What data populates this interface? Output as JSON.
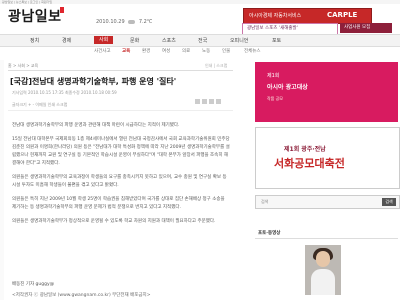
{
  "header": {
    "toplinks": "광남일보 | 뉴스특보 | 로그인 | 회원가입",
    "logo": "광남일보",
    "date": "2010.10.29",
    "temperature": "7.2℃"
  },
  "ads": {
    "ad1_text": "아시아경제 자동차서비스",
    "ad1_brand": "CARPLE",
    "ad2_text": "광남일보 스포츠 '새해출발'",
    "ad3_text": "사업사원 모집"
  },
  "nav": {
    "items": [
      "정치",
      "경제",
      "사회",
      "문화",
      "스포츠",
      "전국",
      "오피니언",
      "포토"
    ]
  },
  "subnav": {
    "items": [
      "사건사고",
      "교육",
      "환경",
      "여성",
      "의료",
      "노동",
      "인물",
      "전체뉴스"
    ]
  },
  "article": {
    "breadcrumb": "홈 > 사회 > 교육",
    "breadcrumb_right": "인쇄 | 스크랩",
    "headline": "[국감]전남대 생명과학기술학부, 파행 운영 '질타'",
    "meta1": "기사입력 2010.10.15 17:35    최종수정 2010.10.18 00:59",
    "meta2": "글자크기  +  -   이메일  인쇄  스크랩",
    "body": [
      "전남대 생명과학기술학부의 파행 운영과 관련해 대책 마련이 시급하다는 지적이 제기됐다.",
      "15일 전남대 대학본부 국제회의동 1층 제4세미나실에서 열린 전남대 국정감사에서 국회 교육과학기술위원회 민주당 김춘진 의원과 이명희(한나라당) 의원 등은 \"전남대가 대학 특성화 정책에 따라 지난 2009년 생명과학기술학부를 설립했으나 현재까지 교원 및 연구실 등 기본적인 학습시설 운영이 부실하다\"며 \"대학 본부가 앞장서 파행을 조속히 해결해야 한다\"고 지적했다.",
      "의원들은 생명과학기술학부의 교육과정이 학생들의 요구를 충족시키지 못하고 있으며, 교수 충원 및 연구실 확보 등 시설 투자도 미흡해 학생들이 불편을 겪고 있다고 밝혔다.",
      "의원들은 특히 지난 2009년 10월 학생 25명이 학습권을 침해받았다며 국가를 상대로 집단 손해배상 청구 소송을 제기하는 등 생명과학기술학부의 파행 운영 문제가 법적 분쟁으로 번지고 있다고 지적했다.",
      "의원들은 생명과학기술학부가 정상적으로 운영될 수 있도록 학교 차원의 지원과 대책이 필요하다고 주문했다."
    ],
    "author": "배동진 기자 guggy@",
    "copyright": "<저작권자 ⓒ 광남일보 (www.gwangnam.co.kr) 무단전재 배포금지>"
  },
  "sidebar": {
    "ad_red_line1": "제1회",
    "ad_red_line2": "아시아 광고대상",
    "ad_red_line3": "작품 공모",
    "ad_white_line1": "제1회 광주·전남",
    "ad_white_line2": "서화공모대축전",
    "search_placeholder": "검색",
    "search_button": "검색",
    "section_title": "포토·동영상"
  }
}
